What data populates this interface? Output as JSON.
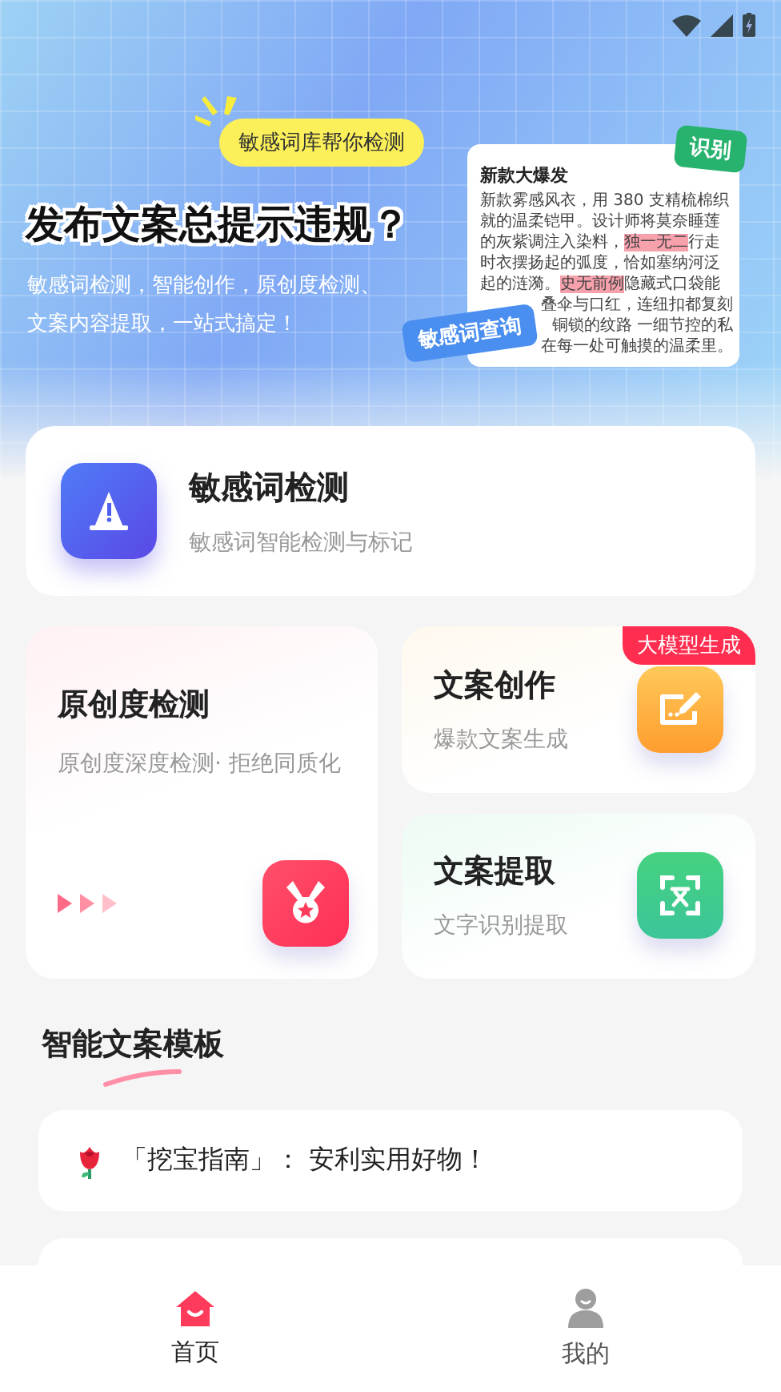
{
  "banner": {
    "bubble": "敏感词库帮你检测",
    "headline": "发布文案总提示违规？",
    "subtitle": [
      "敏感词检测，智能创作，原创度检测、",
      "文案内容提取，一站式搞定！"
    ],
    "demo_card": {
      "title": "新款大爆发",
      "lines": [
        [
          {
            "text": "新款雾感风衣，用 380 支精梳棉织",
            "mark": false
          }
        ],
        [
          {
            "text": "就的温柔铠甲。设计师将莫奈睡莲",
            "mark": false
          }
        ],
        [
          {
            "text": "的灰紫调注入染料，",
            "mark": false
          },
          {
            "text": "独一无二",
            "mark": true
          },
          {
            "text": "行走",
            "mark": false
          }
        ],
        [
          {
            "text": "时衣摆扬起的弧度，恰如塞纳河泛",
            "mark": false
          }
        ],
        [
          {
            "text": "起的涟漪。",
            "mark": false
          },
          {
            "text": "史无前例",
            "mark": true
          },
          {
            "text": "隐藏式口袋能",
            "mark": false
          }
        ],
        [
          {
            "text": "叠伞与口红，连纽扣都复刻",
            "mark": false
          }
        ],
        [
          {
            "text": "铜锁的纹路 一细节控的私",
            "mark": false
          }
        ],
        [
          {
            "text": "在每一处可触摸的温柔里。",
            "mark": false
          }
        ]
      ]
    },
    "tags": [
      {
        "text": "识别",
        "kind": "green"
      },
      {
        "text": "敏感词查询",
        "kind": "blue"
      }
    ]
  },
  "features": [
    {
      "kind": "wide",
      "title": "敏感词检测",
      "subtitle": "敏感词智能检测与标记"
    },
    {
      "kind": "tall",
      "title": "原创度检测",
      "subtitle": "原创度深度检测· 拒绝同质化"
    },
    {
      "kind": "small",
      "title": "文案创作",
      "subtitle": "爆款文案生成",
      "badge": "大模型生成"
    },
    {
      "kind": "small",
      "title": "文案提取",
      "subtitle": "文字识别提取"
    }
  ],
  "section_title": "智能文案模板",
  "templates": [
    {
      "text": "「挖宝指南」： 安利实用好物！"
    }
  ],
  "more_templates_below": true,
  "nav": [
    {
      "label": "首页",
      "selected": true
    },
    {
      "label": "我的",
      "selected": false
    }
  ]
}
